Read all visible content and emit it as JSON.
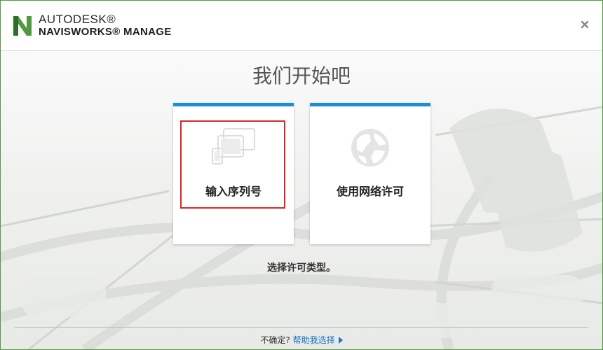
{
  "window": {
    "brand_company": "AUTODESK®",
    "brand_product": "NAVISWORKS® MANAGE",
    "close_icon": "close-icon"
  },
  "main": {
    "heading": "我们开始吧",
    "cards": [
      {
        "label": "输入序列号",
        "icon": "devices-icon"
      },
      {
        "label": "使用网络许可",
        "icon": "globe-icon"
      }
    ],
    "hint": "选择许可类型。"
  },
  "footer": {
    "question": "不确定?",
    "help_link": "帮助我选择"
  },
  "colors": {
    "accent": "#1a8fd6",
    "brand_green": "#4f9a3e",
    "highlight_red": "#d9262b",
    "link": "#1a73c7"
  }
}
